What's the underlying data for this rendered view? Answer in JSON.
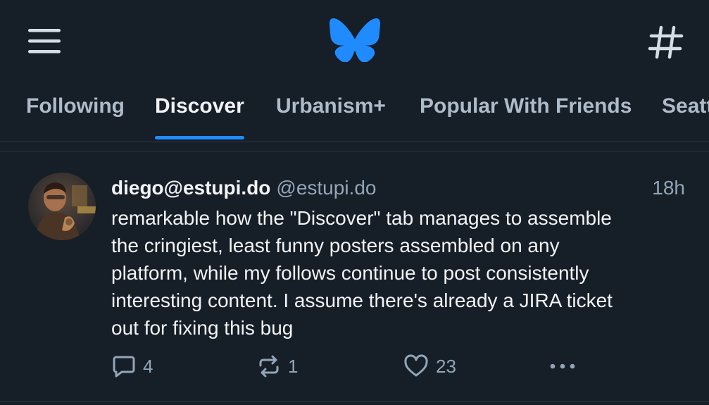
{
  "header": {
    "menu_icon": "hamburger-menu-icon",
    "logo_icon": "butterfly-logo-icon",
    "feeds_icon": "hashtag-icon",
    "brand_color": "#208bfe"
  },
  "tabs": [
    {
      "label": "Following",
      "active": false
    },
    {
      "label": "Discover",
      "active": true
    },
    {
      "label": "Urbanism+",
      "active": false
    },
    {
      "label": "Popular With Friends",
      "active": false
    },
    {
      "label": "Seattle",
      "active": false
    }
  ],
  "post": {
    "display_name": "diego@estupi.do",
    "handle": "@estupi.do",
    "timestamp": "18h",
    "text_lines": [
      "remarkable how the \"Discover\" tab manages to assemble",
      "the cringiest, least funny posters assembled on any",
      "platform, while my follows continue to post consistently",
      "interesting content. I assume there's already a JIRA ticket",
      "out for fixing this bug"
    ],
    "actions": {
      "reply": {
        "icon": "reply-bubble-icon",
        "count": "4"
      },
      "repost": {
        "icon": "repost-icon",
        "count": "1"
      },
      "like": {
        "icon": "heart-icon",
        "count": "23"
      },
      "more": {
        "icon": "more-dots-icon"
      }
    }
  },
  "colors": {
    "background": "#161e27",
    "text": "#f1f3f5",
    "muted_text": "#93a5b7",
    "tab_inactive": "#aebbc9",
    "accent": "#208bfe",
    "divider": "#2e3a48"
  }
}
